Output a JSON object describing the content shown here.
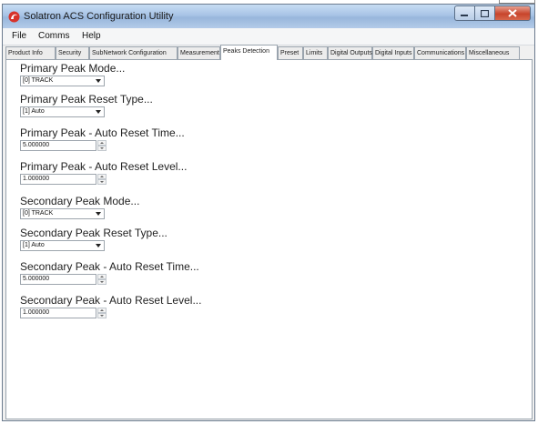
{
  "window": {
    "title": "Solatron ACS Configuration Utility",
    "icon": "solartron-logo-icon",
    "accent": "#d7332b"
  },
  "menu": {
    "items": [
      "File",
      "Comms",
      "Help"
    ]
  },
  "tabs": {
    "items": [
      "Product Info",
      "Security",
      "SubNetwork Configuration",
      "Measurement",
      "Peaks Detection",
      "Preset",
      "Limits",
      "Digital Outputs",
      "Digital Inputs",
      "Communications",
      "Miscellaneous"
    ],
    "active": "Peaks Detection"
  },
  "fields": [
    {
      "label": "Primary Peak Mode...",
      "type": "combo",
      "value": "[0] TRACK"
    },
    {
      "label": "Primary Peak Reset Type...",
      "type": "combo",
      "value": "[1] Auto"
    },
    {
      "label": "Primary Peak - Auto Reset Time...",
      "type": "spin",
      "value": "5.000000"
    },
    {
      "label": "Primary Peak - Auto Reset Level...",
      "type": "spin",
      "value": "1.000000"
    },
    {
      "label": "Secondary Peak Mode...",
      "type": "combo",
      "value": "[0] TRACK"
    },
    {
      "label": "Secondary Peak Reset Type...",
      "type": "combo",
      "value": "[1] Auto"
    },
    {
      "label": "Secondary Peak - Auto Reset Time...",
      "type": "spin",
      "value": "5.000000"
    },
    {
      "label": "Secondary Peak - Auto Reset Level...",
      "type": "spin",
      "value": "1.000000"
    }
  ]
}
